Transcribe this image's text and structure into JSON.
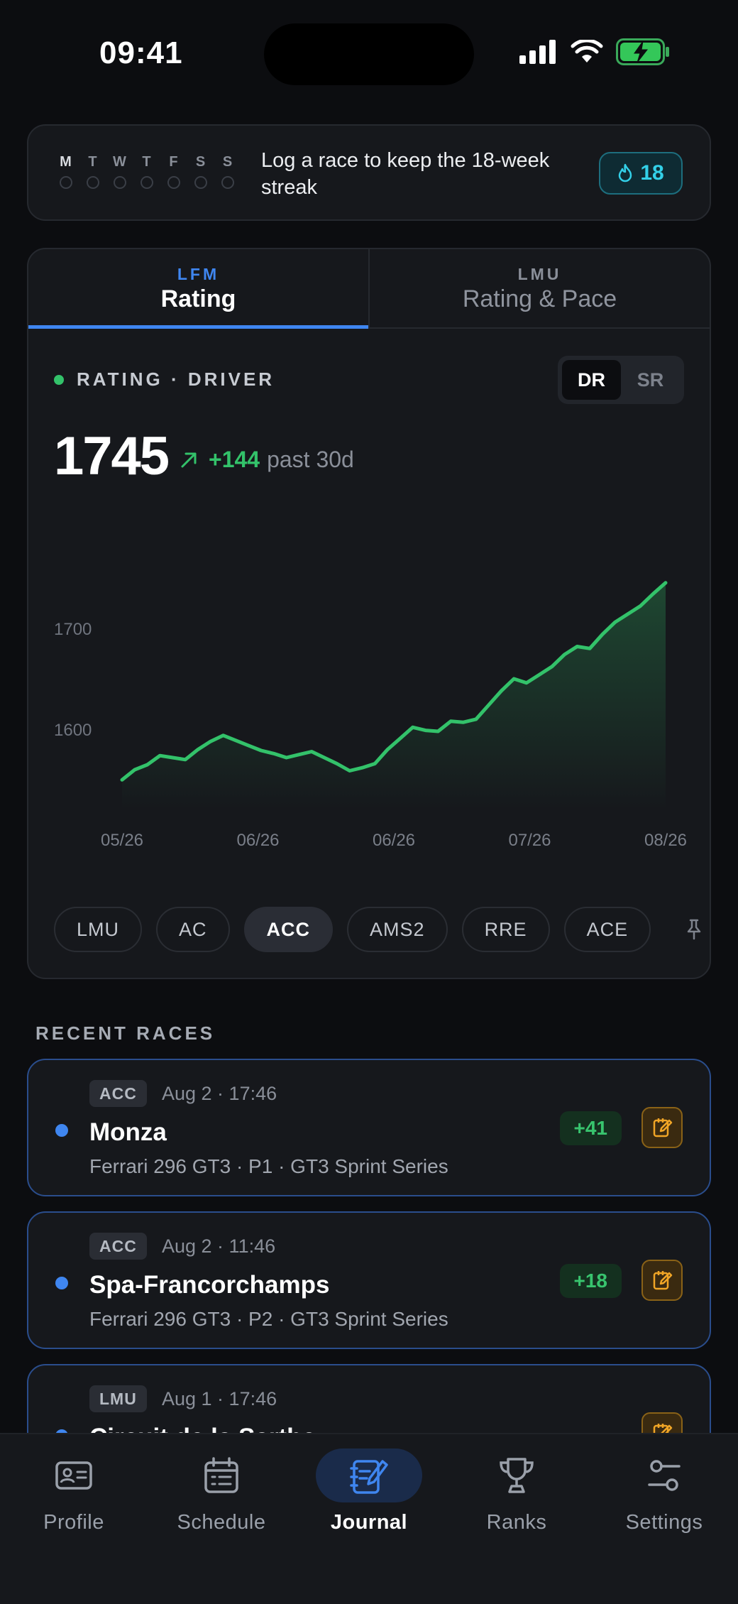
{
  "status": {
    "time": "09:41"
  },
  "streak": {
    "days": [
      "M",
      "T",
      "W",
      "T",
      "F",
      "S",
      "S"
    ],
    "message": "Log a race to keep the 18-week streak",
    "count": "18"
  },
  "tabs": [
    {
      "kicker": "LFM",
      "title": "Rating",
      "active": true
    },
    {
      "kicker": "LMU",
      "title": "Rating & Pace",
      "active": false
    }
  ],
  "metric": {
    "label": "RATING · DRIVER",
    "toggle": [
      "DR",
      "SR"
    ],
    "value": "1745",
    "delta": "+144",
    "period": "past 30d"
  },
  "chart_data": {
    "type": "area",
    "x_ticks": [
      "05/26",
      "06/26",
      "06/26",
      "07/26",
      "08/26"
    ],
    "y_ticks": [
      1600,
      1700
    ],
    "ylim": [
      1520,
      1780
    ],
    "values": [
      1550,
      1560,
      1565,
      1574,
      1572,
      1570,
      1580,
      1588,
      1594,
      1589,
      1584,
      1579,
      1576,
      1572,
      1575,
      1578,
      1572,
      1566,
      1559,
      1562,
      1566,
      1580,
      1591,
      1602,
      1599,
      1598,
      1608,
      1607,
      1610,
      1624,
      1638,
      1650,
      1646,
      1654,
      1662,
      1674,
      1682,
      1680,
      1694,
      1706,
      1714,
      1722,
      1734,
      1745
    ],
    "line_color": "#33c26a"
  },
  "platforms": [
    "LMU",
    "AC",
    "ACC",
    "AMS2",
    "RRE",
    "ACE"
  ],
  "active_platform": "ACC",
  "recent": {
    "title": "RECENT RACES",
    "races": [
      {
        "tag": "ACC",
        "time": "Aug 2 · 17:46",
        "track": "Monza",
        "sub": "Ferrari 296 GT3 · P1 · GT3 Sprint Series",
        "delta": "+41"
      },
      {
        "tag": "ACC",
        "time": "Aug 2 · 11:46",
        "track": "Spa-Francorchamps",
        "sub": "Ferrari 296 GT3 · P2 · GT3 Sprint Series",
        "delta": "+18"
      },
      {
        "tag": "LMU",
        "time": "Aug 1 · 17:46",
        "track": "Circuit de la Sarthe",
        "sub": "",
        "delta": ""
      }
    ]
  },
  "nav": [
    {
      "label": "Profile",
      "icon": "profile-icon"
    },
    {
      "label": "Schedule",
      "icon": "schedule-icon"
    },
    {
      "label": "Journal",
      "icon": "journal-icon",
      "active": true
    },
    {
      "label": "Ranks",
      "icon": "trophy-icon"
    },
    {
      "label": "Settings",
      "icon": "sliders-icon"
    }
  ]
}
